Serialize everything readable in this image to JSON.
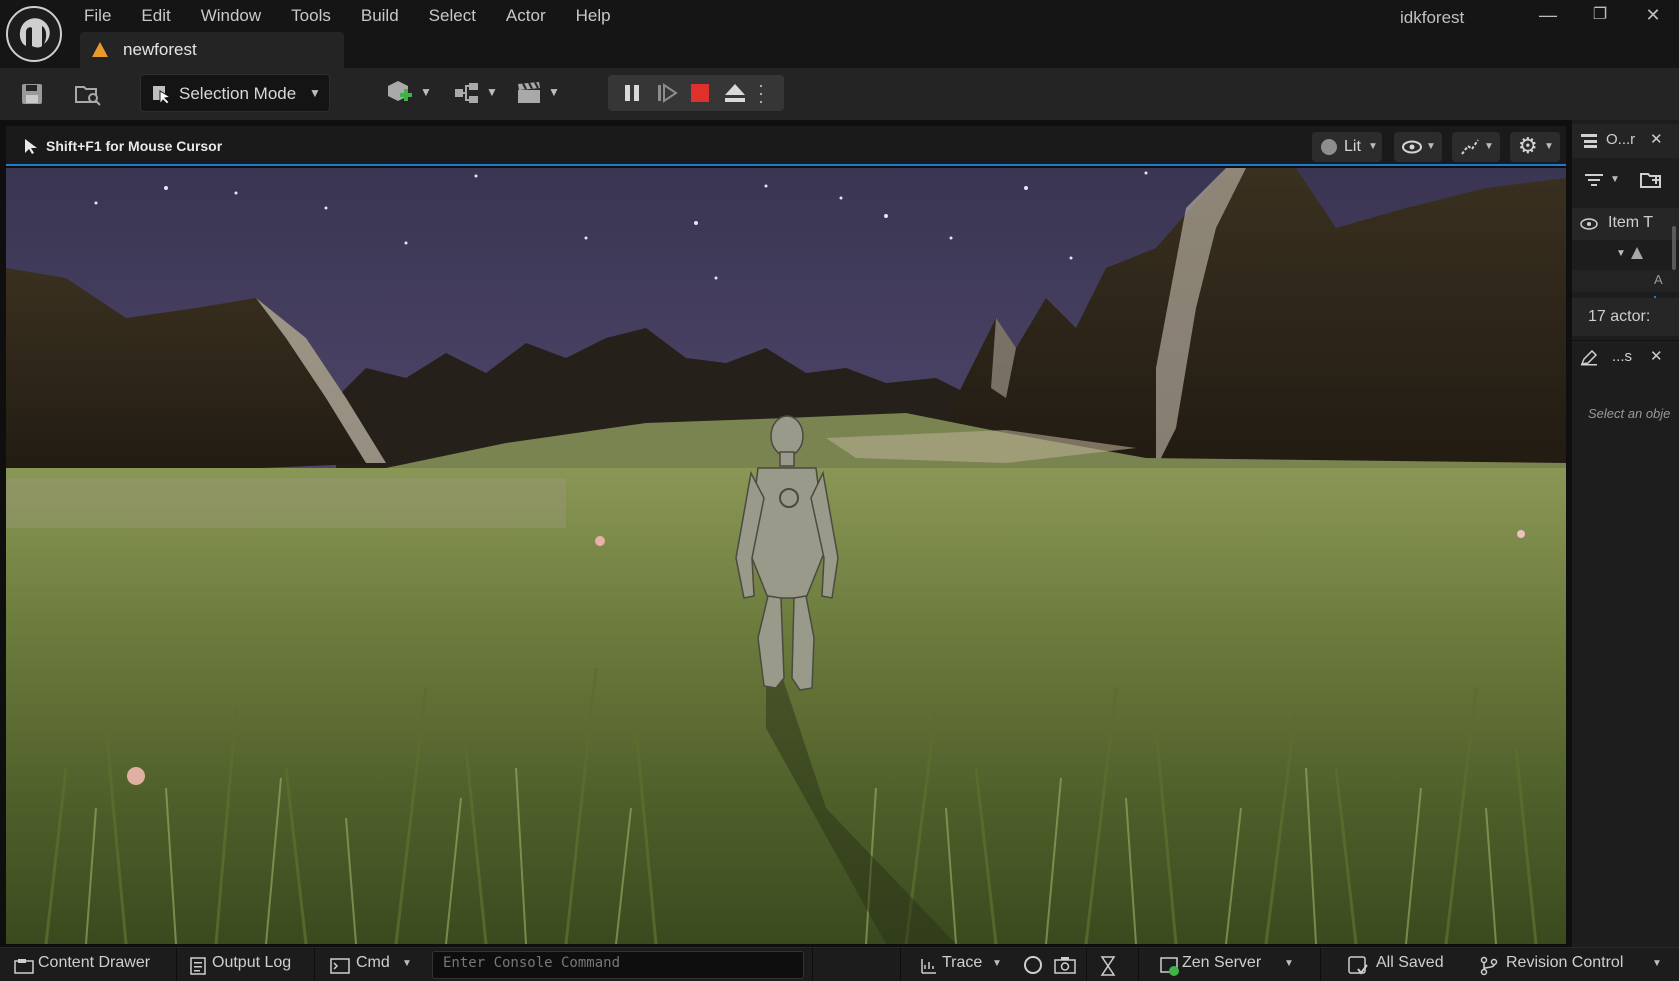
{
  "menu": [
    "File",
    "Edit",
    "Window",
    "Tools",
    "Build",
    "Select",
    "Actor",
    "Help"
  ],
  "project_name": "idkforest",
  "window_controls": {
    "minimize": "—",
    "restore": "❐",
    "close": "✕"
  },
  "tab": {
    "label": "newforest"
  },
  "toolbar": {
    "selection_mode": "Selection Mode"
  },
  "viewport": {
    "hint": "Shift+F1 for Mouse Cursor",
    "view_mode": "Lit"
  },
  "outliner": {
    "title": "O...r",
    "column": "Item T",
    "actor_count": "17 actor:",
    "row_marker": "A"
  },
  "details": {
    "title": "...s",
    "empty_text": "Select an obje"
  },
  "statusbar": {
    "content_drawer": "Content Drawer",
    "output_log": "Output Log",
    "cmd": "Cmd",
    "console_placeholder": "Enter Console Command",
    "trace": "Trace",
    "zen_server": "Zen Server",
    "all_saved": "All Saved",
    "revision_control": "Revision Control"
  },
  "colors": {
    "accent_blue": "#1b7bd0",
    "stop_red": "#e0302b",
    "warning_orange": "#e89a2d",
    "zen_green": "#3db34a"
  }
}
